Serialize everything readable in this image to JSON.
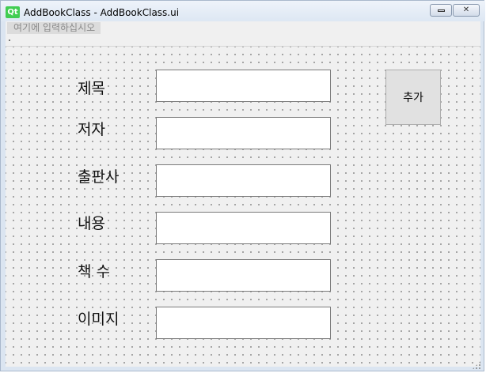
{
  "window": {
    "title": "AddBookClass - AddBookClass.ui",
    "app_icon_text": "Qt",
    "minimize_label": "",
    "close_label": "✕"
  },
  "menubar": {
    "placeholder_item": "여기에 입력하십시오"
  },
  "form": {
    "fields": [
      {
        "label": "제목",
        "value": ""
      },
      {
        "label": "저자",
        "value": ""
      },
      {
        "label": "출판사",
        "value": ""
      },
      {
        "label": "내용",
        "value": ""
      },
      {
        "label": "책 수",
        "value": ""
      },
      {
        "label": "이미지",
        "value": ""
      }
    ],
    "add_button_label": "추가"
  },
  "colors": {
    "qt_green": "#41cd52",
    "canvas_bg": "#f0f0f0",
    "button_bg": "#e1e1e1"
  }
}
